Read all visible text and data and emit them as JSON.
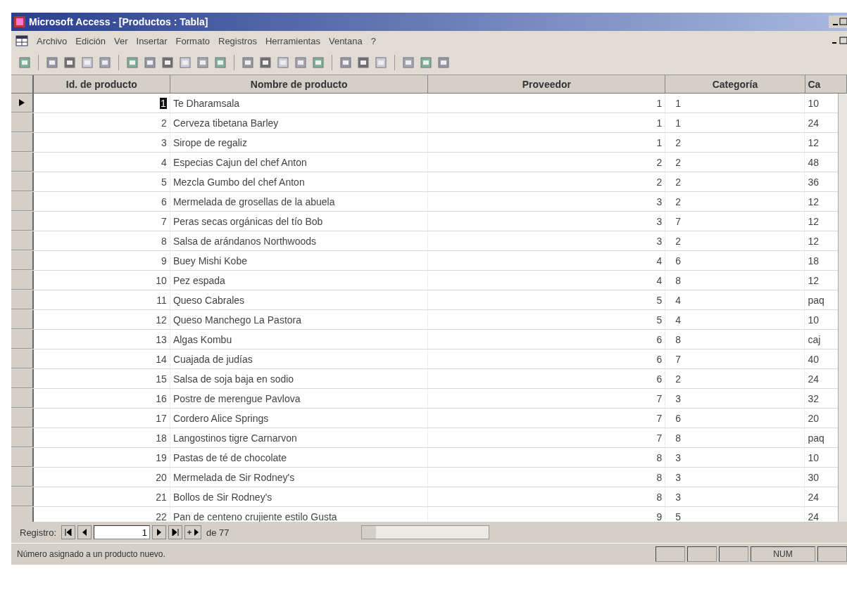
{
  "window": {
    "title": "Microsoft Access - [Productos : Tabla]"
  },
  "menu": [
    "Archivo",
    "Edición",
    "Ver",
    "Insertar",
    "Formato",
    "Registros",
    "Herramientas",
    "Ventana",
    "?"
  ],
  "table": {
    "columns": [
      "Id. de producto",
      "Nombre de producto",
      "Proveedor",
      "Categoría",
      "Ca"
    ],
    "rows": [
      {
        "id": "1",
        "name": "Te Dharamsala",
        "proveedor": "1",
        "categoria": "1",
        "cantidad": "10",
        "current": true
      },
      {
        "id": "2",
        "name": "Cerveza tibetana Barley",
        "proveedor": "1",
        "categoria": "1",
        "cantidad": "24",
        "current": false
      },
      {
        "id": "3",
        "name": "Sirope de regaliz",
        "proveedor": "1",
        "categoria": "2",
        "cantidad": "12",
        "current": false
      },
      {
        "id": "4",
        "name": "Especias Cajun del chef Anton",
        "proveedor": "2",
        "categoria": "2",
        "cantidad": "48",
        "current": false
      },
      {
        "id": "5",
        "name": "Mezcla Gumbo del chef Anton",
        "proveedor": "2",
        "categoria": "2",
        "cantidad": "36",
        "current": false
      },
      {
        "id": "6",
        "name": "Mermelada de grosellas de la abuela",
        "proveedor": "3",
        "categoria": "2",
        "cantidad": "12",
        "current": false
      },
      {
        "id": "7",
        "name": "Peras secas orgánicas del tío Bob",
        "proveedor": "3",
        "categoria": "7",
        "cantidad": "12",
        "current": false
      },
      {
        "id": "8",
        "name": "Salsa de arándanos Northwoods",
        "proveedor": "3",
        "categoria": "2",
        "cantidad": "12",
        "current": false
      },
      {
        "id": "9",
        "name": "Buey Mishi Kobe",
        "proveedor": "4",
        "categoria": "6",
        "cantidad": "18",
        "current": false
      },
      {
        "id": "10",
        "name": "Pez espada",
        "proveedor": "4",
        "categoria": "8",
        "cantidad": "12",
        "current": false
      },
      {
        "id": "11",
        "name": "Queso Cabrales",
        "proveedor": "5",
        "categoria": "4",
        "cantidad": "paq",
        "current": false
      },
      {
        "id": "12",
        "name": "Queso Manchego La Pastora",
        "proveedor": "5",
        "categoria": "4",
        "cantidad": "10",
        "current": false
      },
      {
        "id": "13",
        "name": "Algas Kombu",
        "proveedor": "6",
        "categoria": "8",
        "cantidad": "caj",
        "current": false
      },
      {
        "id": "14",
        "name": "Cuajada de judías",
        "proveedor": "6",
        "categoria": "7",
        "cantidad": "40",
        "current": false
      },
      {
        "id": "15",
        "name": "Salsa de soja baja en sodio",
        "proveedor": "6",
        "categoria": "2",
        "cantidad": "24",
        "current": false
      },
      {
        "id": "16",
        "name": "Postre de merengue Pavlova",
        "proveedor": "7",
        "categoria": "3",
        "cantidad": "32",
        "current": false
      },
      {
        "id": "17",
        "name": "Cordero Alice Springs",
        "proveedor": "7",
        "categoria": "6",
        "cantidad": "20",
        "current": false
      },
      {
        "id": "18",
        "name": "Langostinos tigre Carnarvon",
        "proveedor": "7",
        "categoria": "8",
        "cantidad": "paq",
        "current": false
      },
      {
        "id": "19",
        "name": "Pastas de té de chocolate",
        "proveedor": "8",
        "categoria": "3",
        "cantidad": "10",
        "current": false
      },
      {
        "id": "20",
        "name": "Mermelada de Sir Rodney's",
        "proveedor": "8",
        "categoria": "3",
        "cantidad": "30",
        "current": false
      },
      {
        "id": "21",
        "name": "Bollos de Sir Rodney's",
        "proveedor": "8",
        "categoria": "3",
        "cantidad": "24",
        "current": false
      },
      {
        "id": "22",
        "name": "Pan de centeno crujiente estilo Gusta",
        "proveedor": "9",
        "categoria": "5",
        "cantidad": "24",
        "current": false
      }
    ]
  },
  "navigation": {
    "label": "Registro:",
    "record": "1",
    "total": "de 77"
  },
  "status_bar": {
    "message": "Número asignado a un producto nuevo.",
    "indicator": "NUM"
  }
}
